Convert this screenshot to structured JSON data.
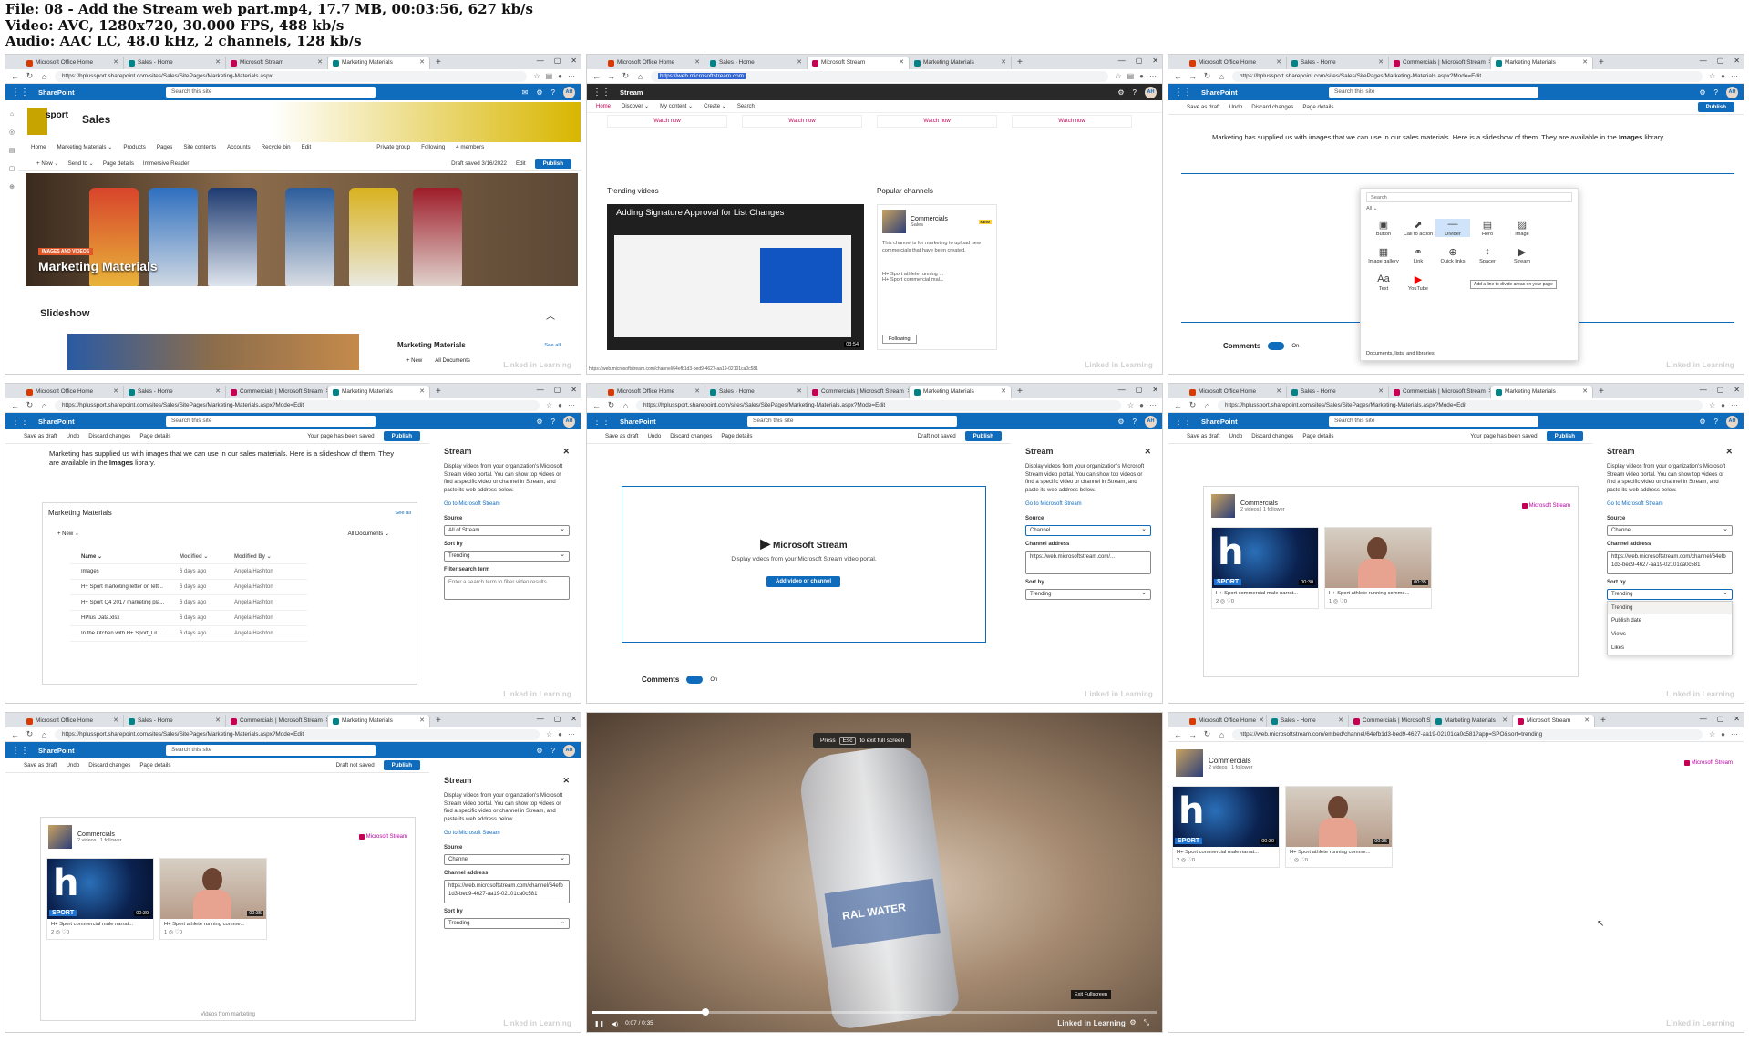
{
  "file_info": {
    "line1": "File: 08 - Add the Stream web part.mp4, 17.7 MB, 00:03:56, 627 kb/s",
    "line2": "Video: AVC, 1280x720, 30.000 FPS, 488 kb/s",
    "line3": "Audio: AAC LC, 48.0 kHz, 2 channels, 128 kb/s"
  },
  "common": {
    "tab_office": "Microsoft Office Home",
    "tab_sales": "Sales - Home",
    "tab_stream": "Microsoft Stream",
    "tab_commercials": "Commercials | Microsoft Stream",
    "tab_marketing": "Marketing Materials",
    "url_marketing": "https://hplussport.sharepoint.com/sites/Sales/SitePages/Marketing-Materials.aspx",
    "url_marketing_edit": "https://hplussport.sharepoint.com/sites/Sales/SitePages/Marketing-Materials.aspx?Mode=Edit",
    "sharepoint": "SharePoint",
    "search_site": "Search this site",
    "avatar": "AH",
    "save_draft": "Save as draft",
    "undo": "Undo",
    "discard": "Discard changes",
    "page_details": "Page details",
    "publish": "Publish",
    "saved": "Your page has been saved",
    "not_saved": "Draft not saved",
    "watermark": "Linked in Learning",
    "pane_title": "Stream",
    "pane_desc": "Display videos from your organization's Microsoft Stream video portal. You can show top videos or find a specific video or channel in Stream, and paste its web address below.",
    "pane_link": "Go to Microsoft Stream",
    "source": "Source",
    "sort_by": "Sort by",
    "trending": "Trending",
    "channel": "Channel",
    "channel_address": "Channel address",
    "channel_url": "https://web.microsoftstream.com/channel/64efb1d3-bed9-4627-aa19-02101ca0c581",
    "channel_url_short": "https://web.microsoftstream.com/...",
    "commercials": "Commercials",
    "commercials_sub": "2 videos | 1 follower",
    "ms_stream": "Microsoft Stream",
    "video1_title": "H+ Sport commercial male narrat...",
    "video2_title": "H+ Sport athlete running comme...",
    "video1_dur": "00:30",
    "video2_dur": "00:35",
    "video1_stats": "2 ◎ ♡0",
    "video2_stats": "1 ◎ ♡0",
    "comments": "Comments",
    "on": "On"
  },
  "tile1": {
    "site_name": "Sales",
    "logo": "sport",
    "nav": [
      "Home",
      "Marketing Materials ⌄",
      "Products",
      "Pages",
      "Site contents",
      "Accounts",
      "Recycle bin",
      "Edit"
    ],
    "group": "Private group",
    "following": "Following",
    "members": "4 members",
    "cmds": [
      "+ New ⌄",
      "Send to ⌄",
      "Page details",
      "Immersive Reader"
    ],
    "draft_saved": "Draft saved 3/16/2022",
    "edit": "Edit",
    "chip": "IMAGES AND VIDEOS",
    "hero_title": "Marketing Materials",
    "section": "Slideshow",
    "lib": "Marketing Materials",
    "see_all": "See all",
    "new": "+ New",
    "all_docs": "All Documents"
  },
  "tile2": {
    "url": "https://web.microsoftstream.com",
    "app": "Stream",
    "nav": [
      "Home",
      "Discover ⌄",
      "My content ⌄",
      "Create ⌄",
      "Search"
    ],
    "watch_now": "Watch now",
    "trending": "Trending videos",
    "popular": "Popular channels",
    "video_title": "Adding Signature Approval for List Changes",
    "video_dur": "03:54",
    "channel_name": "Commercials",
    "channel_owner": "Sales",
    "new_badge": "NEW",
    "channel_desc": "This channel is for marketing to upload new commercials that have been created.",
    "ch_items": [
      "H+ Sport athlete running ...",
      "H+ Sport commercial mal..."
    ],
    "following_btn": "Following",
    "status_url": "https://web.microsoftstream.com/channel/64efb1d3-bed9-4627-aa19-02101ca0c581"
  },
  "tile3": {
    "para": "Marketing has supplied us with images that we can use in our sales materials. Here is a slideshow of them. They are available in the",
    "para_bold": "Images",
    "para_end": "library.",
    "search": "Search",
    "filter": "All ⌄",
    "items": [
      {
        "icon": "▣",
        "label": "Button"
      },
      {
        "icon": "⬈",
        "label": "Call to action"
      },
      {
        "icon": "—",
        "label": "Divider"
      },
      {
        "icon": "▤",
        "label": "Hero"
      },
      {
        "icon": "▨",
        "label": "Image"
      },
      {
        "icon": "▦",
        "label": "Image gallery"
      },
      {
        "icon": "⚭",
        "label": "Link"
      },
      {
        "icon": "⊕",
        "label": "Quick links"
      },
      {
        "icon": "↕",
        "label": "Spacer"
      },
      {
        "icon": "▶",
        "label": "Stream"
      },
      {
        "icon": "Aa",
        "label": "Text"
      },
      {
        "icon": "▶",
        "label": "YouTube"
      }
    ],
    "tooltip": "Add a line to divide areas on your page",
    "footer": "Documents, lists, and libraries"
  },
  "tile4": {
    "lib": "Marketing Materials",
    "see_all": "See all",
    "new": "+ New ⌄",
    "all_docs": "All Documents ⌄",
    "headers": [
      "Name ⌄",
      "Modified ⌄",
      "Modified By ⌄"
    ],
    "rows": [
      [
        "Images",
        "6 days ago",
        "Angela Hashton"
      ],
      [
        "H+ Sport marketing letter on lett...",
        "6 days ago",
        "Angela Hashton"
      ],
      [
        "H+ Sport Q4 2017 marketing pla...",
        "6 days ago",
        "Angela Hashton"
      ],
      [
        "HPlus Data.xlsx",
        "6 days ago",
        "Angela Hashton"
      ],
      [
        "In the kitchen with H+ Sport_Lil...",
        "6 days ago",
        "Angela Hashton"
      ]
    ],
    "source_val": "All of Stream",
    "filter": "Filter search term",
    "filter_ph": "Enter a search term to filter video results."
  },
  "tile5": {
    "ms_stream": "Microsoft Stream",
    "desc": "Display videos from your Microsoft Stream video portal.",
    "button": "Add video or channel"
  },
  "tile6": {
    "options": [
      "Trending",
      "Publish date",
      "Views",
      "Likes"
    ]
  },
  "tile7": {
    "footer": "Videos from marketing"
  },
  "tile8": {
    "esc_prefix": "Press",
    "esc_key": "Esc",
    "esc_suffix": "to exit full screen",
    "exit_btn": "Exit Fullscreen",
    "time": "0:07 / 0:35",
    "progress": 0.2,
    "bottle_text": "RAL WATER"
  },
  "tile9": {
    "url": "https://web.microsoftstream.com/embed/channel/64efb1d3-bed9-4627-aa19-02101ca0c581?app=SPO&sort=trending"
  }
}
